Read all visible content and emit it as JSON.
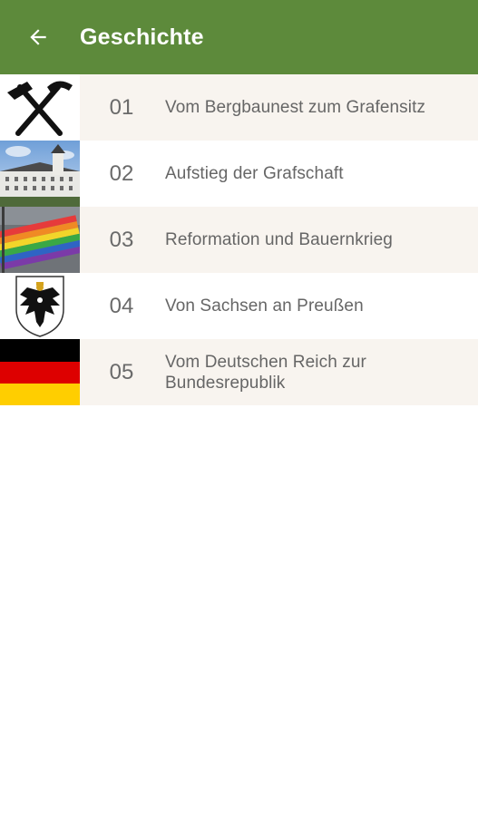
{
  "toolbar": {
    "title": "Geschichte",
    "back_icon": "arrow-left-icon",
    "background": "#5d8a3b"
  },
  "list": {
    "items": [
      {
        "number": "01",
        "title": "Vom Bergbaunest zum Grafensitz",
        "image": "hammer-and-pick-icon"
      },
      {
        "number": "02",
        "title": "Aufstieg der Grafschaft",
        "image": "castle-photo"
      },
      {
        "number": "03",
        "title": "Reformation und Bauernkrieg",
        "image": "rainbow-flag-photo"
      },
      {
        "number": "04",
        "title": "Von Sachsen an Preußen",
        "image": "prussian-eagle-coat-of-arms"
      },
      {
        "number": "05",
        "title": "Vom Deutschen Reich zur Bundesrepublik",
        "image": "german-flag"
      }
    ],
    "row_colors": {
      "shaded": "#f8f4ef",
      "plain": "#ffffff"
    }
  }
}
